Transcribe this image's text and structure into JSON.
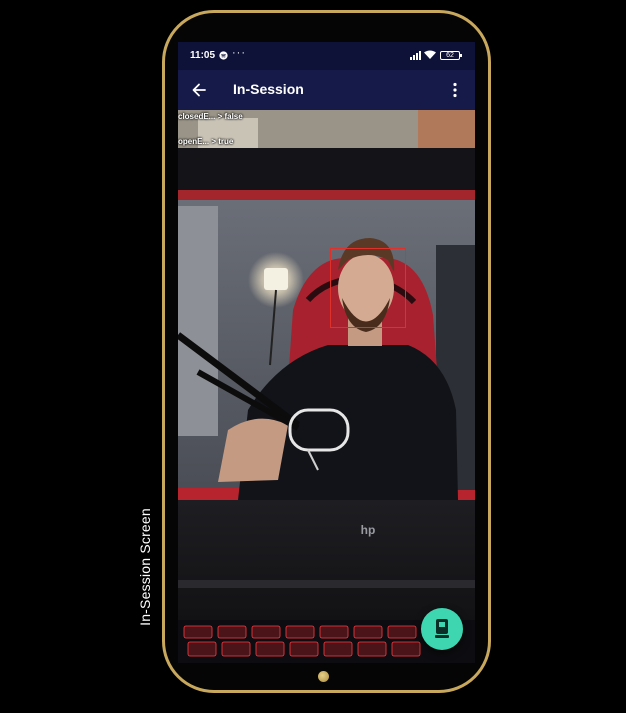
{
  "caption": "In-Session Screen",
  "status_bar": {
    "time": "11:05",
    "more": "···",
    "battery": "62"
  },
  "app_bar": {
    "title": "In-Session"
  },
  "overlay": {
    "closed_eyes": "closedE... > false",
    "open_eyes": "openE... > true"
  },
  "colors": {
    "status_bar": "#0e1238",
    "app_bar": "#161a48",
    "face_box": "#e0302a",
    "fab": "#3dd6b0",
    "phone_frame": "#c8a85c"
  },
  "icons": {
    "back": "arrow-left-icon",
    "menu": "more-vert-icon",
    "fab": "device-icon"
  }
}
